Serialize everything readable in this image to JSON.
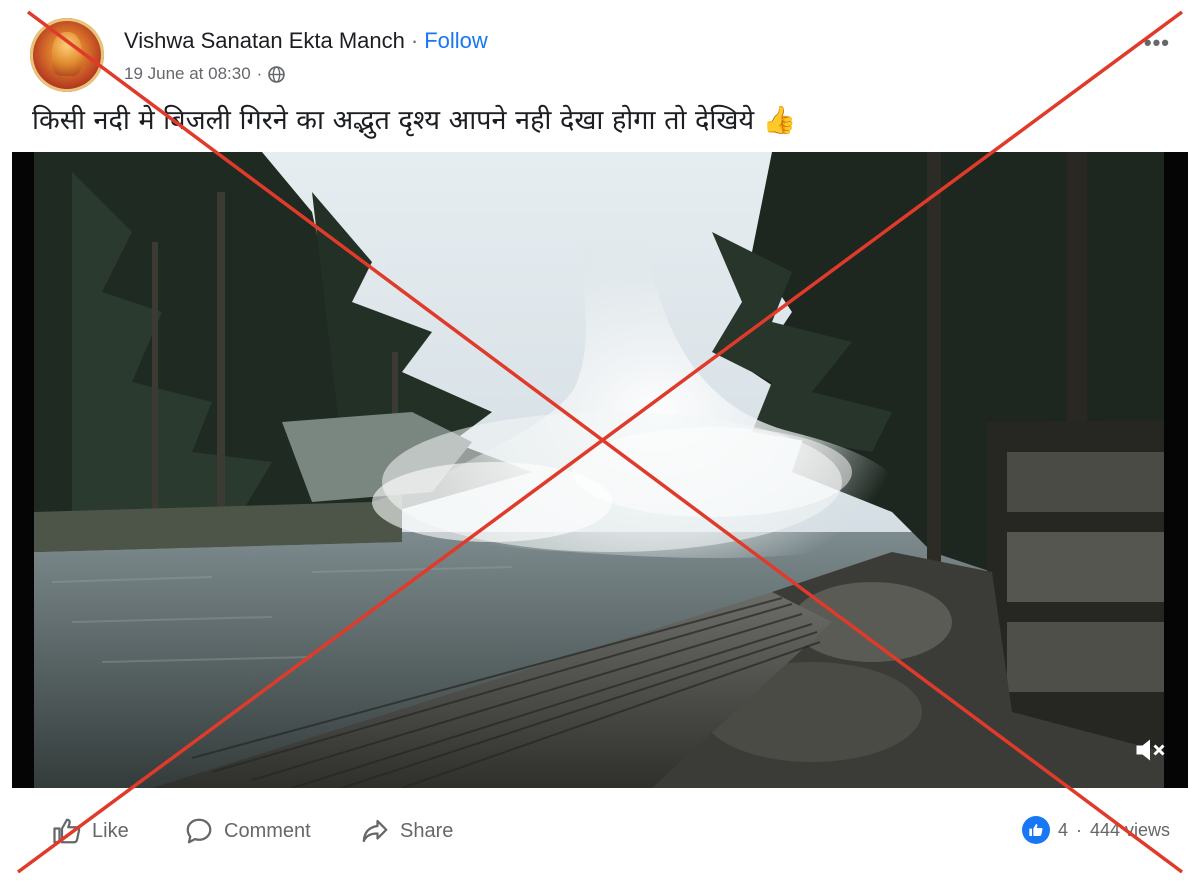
{
  "post": {
    "author": "Vishwa Sanatan Ekta Manch",
    "separator": "·",
    "follow_label": "Follow",
    "timestamp": "19 June at 08:30",
    "meta_sep": "·",
    "more_label": "•••",
    "caption": "किसी नदी मे बिजली गिरने का अद्भुत दृश्य आपने नही देखा होगा तो देखिये 👍"
  },
  "actions": {
    "like_label": "Like",
    "comment_label": "Comment",
    "share_label": "Share"
  },
  "stats": {
    "reactions": "4",
    "dot": "·",
    "views": "444 views"
  },
  "colors": {
    "facebook_blue": "#1877f2",
    "cross_red": "#e03a2a",
    "secondary_text": "#65676b"
  }
}
